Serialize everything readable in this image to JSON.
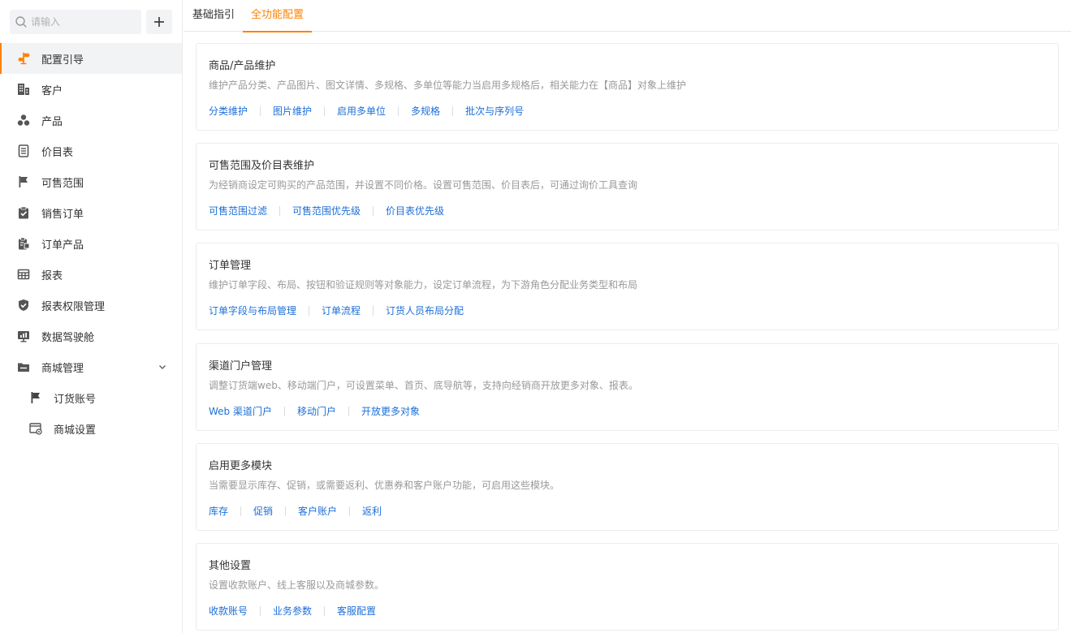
{
  "search": {
    "placeholder": "请输入"
  },
  "sidebar": {
    "items": [
      {
        "label": "配置引导",
        "icon": "signpost-icon",
        "active": true
      },
      {
        "label": "客户",
        "icon": "building-icon"
      },
      {
        "label": "产品",
        "icon": "cubes-icon"
      },
      {
        "label": "价目表",
        "icon": "list-document-icon"
      },
      {
        "label": "可售范围",
        "icon": "flag-icon"
      },
      {
        "label": "销售订单",
        "icon": "clipboard-check-icon"
      },
      {
        "label": "订单产品",
        "icon": "order-product-icon"
      },
      {
        "label": "报表",
        "icon": "table-icon"
      },
      {
        "label": "报表权限管理",
        "icon": "shield-check-icon"
      },
      {
        "label": "数据驾驶舱",
        "icon": "dashboard-monitor-icon"
      },
      {
        "label": "商城管理",
        "icon": "folder-icon",
        "expanded": true
      },
      {
        "label": "订货账号",
        "icon": "flag-icon",
        "sub": true
      },
      {
        "label": "商城设置",
        "icon": "window-gear-icon",
        "sub": true
      }
    ]
  },
  "tabs": [
    {
      "label": "基础指引"
    },
    {
      "label": "全功能配置",
      "active": true
    }
  ],
  "colors": {
    "accent": "#ff8000",
    "link": "#1d6fd8",
    "muted": "#999999"
  },
  "cards": [
    {
      "title": "商品/产品维护",
      "desc": "维护产品分类、产品图片、图文详情、多规格、多单位等能力当启用多规格后，相关能力在【商品】对象上维护",
      "links": [
        "分类维护",
        "图片维护",
        "启用多单位",
        "多规格",
        "批次与序列号"
      ]
    },
    {
      "title": "可售范围及价目表维护",
      "desc": "为经销商设定可购买的产品范围，并设置不同价格。设置可售范围、价目表后，可通过询价工具查询",
      "links": [
        "可售范围过滤",
        "可售范围优先级",
        "价目表优先级"
      ]
    },
    {
      "title": "订单管理",
      "desc": "维护订单字段、布局、按钮和验证规则等对象能力，设定订单流程，为下游角色分配业务类型和布局",
      "links": [
        "订单字段与布局管理",
        "订单流程",
        "订货人员布局分配"
      ]
    },
    {
      "title": "渠道门户管理",
      "desc": "调整订货端web、移动端门户，可设置菜单、首页、底导航等，支持向经销商开放更多对象、报表。",
      "links": [
        "Web 渠道门户",
        "移动门户",
        "开放更多对象"
      ]
    },
    {
      "title": "启用更多模块",
      "desc": "当需要显示库存、促销，或需要返利、优惠券和客户账户功能，可启用这些模块。",
      "links": [
        "库存",
        "促销",
        "客户账户",
        "返利"
      ]
    },
    {
      "title": "其他设置",
      "desc": "设置收款账户、线上客服以及商城参数。",
      "links": [
        "收款账号",
        "业务参数",
        "客服配置"
      ]
    }
  ]
}
